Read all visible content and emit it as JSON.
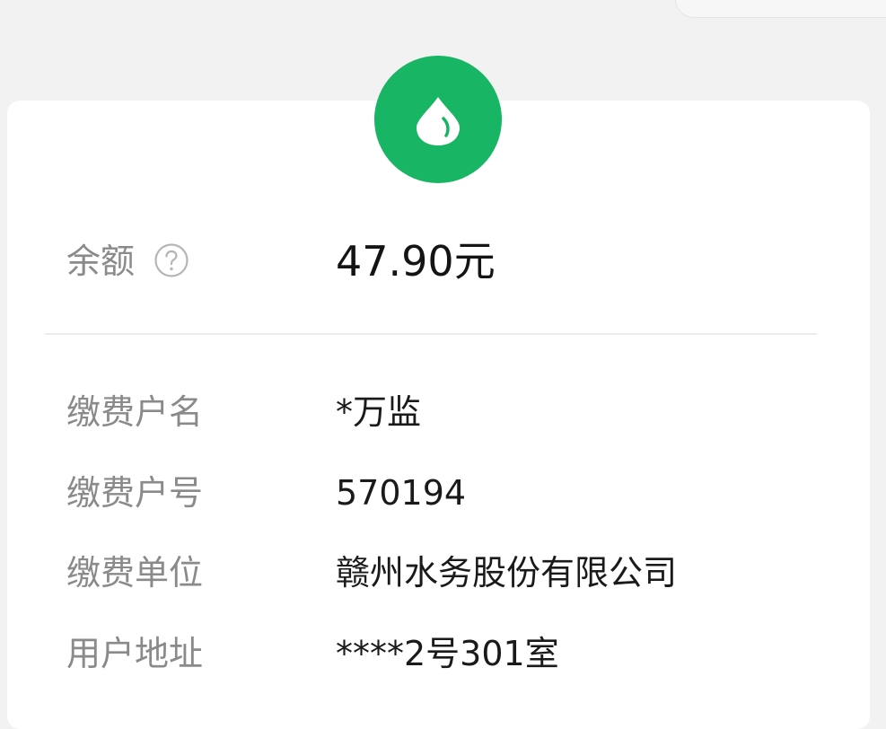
{
  "colors": {
    "page_background": "#f2f2f2",
    "card_background": "#ffffff",
    "icon_green": "#17b564",
    "label_gray": "#8a8a8a",
    "value_text": "#1a1a1a"
  },
  "header": {
    "service_icon": "water-drop-icon"
  },
  "balance": {
    "label": "余额",
    "help_icon": "question-circle-icon",
    "value": "47.90元"
  },
  "details": {
    "payer_name": {
      "label": "缴费户名",
      "value": "*万监"
    },
    "payer_number": {
      "label": "缴费户号",
      "value": "570194"
    },
    "payee_unit": {
      "label": "缴费单位",
      "value": "赣州水务股份有限公司"
    },
    "user_address": {
      "label": "用户地址",
      "value": "****2号301室"
    }
  }
}
